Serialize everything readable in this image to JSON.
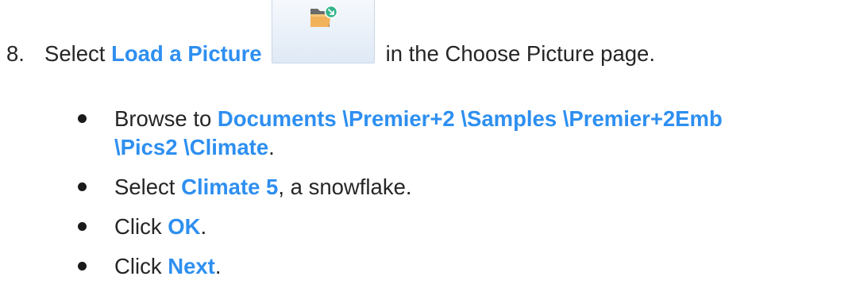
{
  "step": {
    "number": "8.",
    "prefix": "Select ",
    "action": "Load a Picture",
    "suffix": "in the Choose Picture page.",
    "button_icon": "folder-load-icon"
  },
  "bullets": [
    {
      "prefix": "Browse to ",
      "path_line1": "Documents \\Premier+2 \\Samples \\Premier+2Emb",
      "path_line2": "\\Pics2 \\Climate",
      "suffix": "."
    },
    {
      "prefix": "Select ",
      "target": "Climate 5",
      "suffix": ", a snowflake."
    },
    {
      "prefix": "Click ",
      "target": "OK",
      "suffix": "."
    },
    {
      "prefix": "Click ",
      "target": "Next",
      "suffix": "."
    }
  ],
  "colors": {
    "highlight": "#2e8ff0",
    "text": "#262626",
    "folder": "#f2b25b",
    "badge": "#33b48a"
  }
}
